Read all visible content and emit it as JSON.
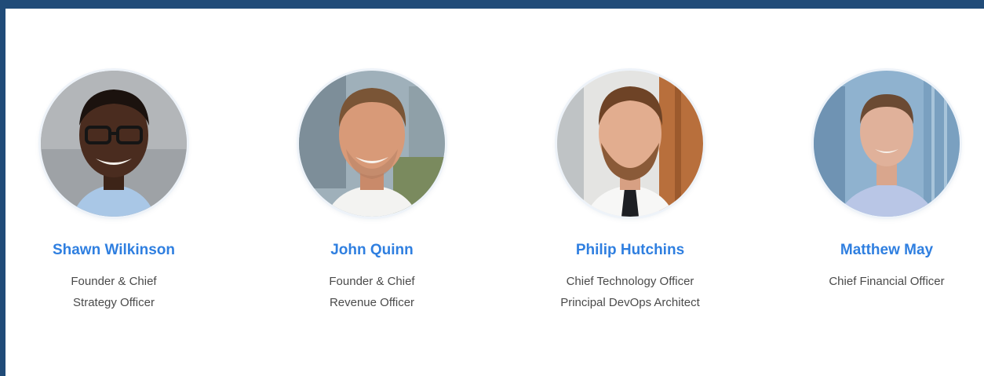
{
  "team": {
    "members": [
      {
        "name": "Shawn Wilkinson",
        "title_line1": "Founder & Chief",
        "title_line2": "Strategy Officer"
      },
      {
        "name": "John Quinn",
        "title_line1": "Founder & Chief",
        "title_line2": "Revenue Officer"
      },
      {
        "name": "Philip Hutchins",
        "title_line1": "Chief Technology Officer",
        "title_line2": "Principal DevOps Architect"
      },
      {
        "name": "Matthew May",
        "title_line1": "Chief Financial Officer",
        "title_line2": ""
      }
    ]
  },
  "colors": {
    "frame": "#204b78",
    "name_text": "#2f7fe0",
    "role_text": "#4a4a4a",
    "background": "#ffffff"
  }
}
